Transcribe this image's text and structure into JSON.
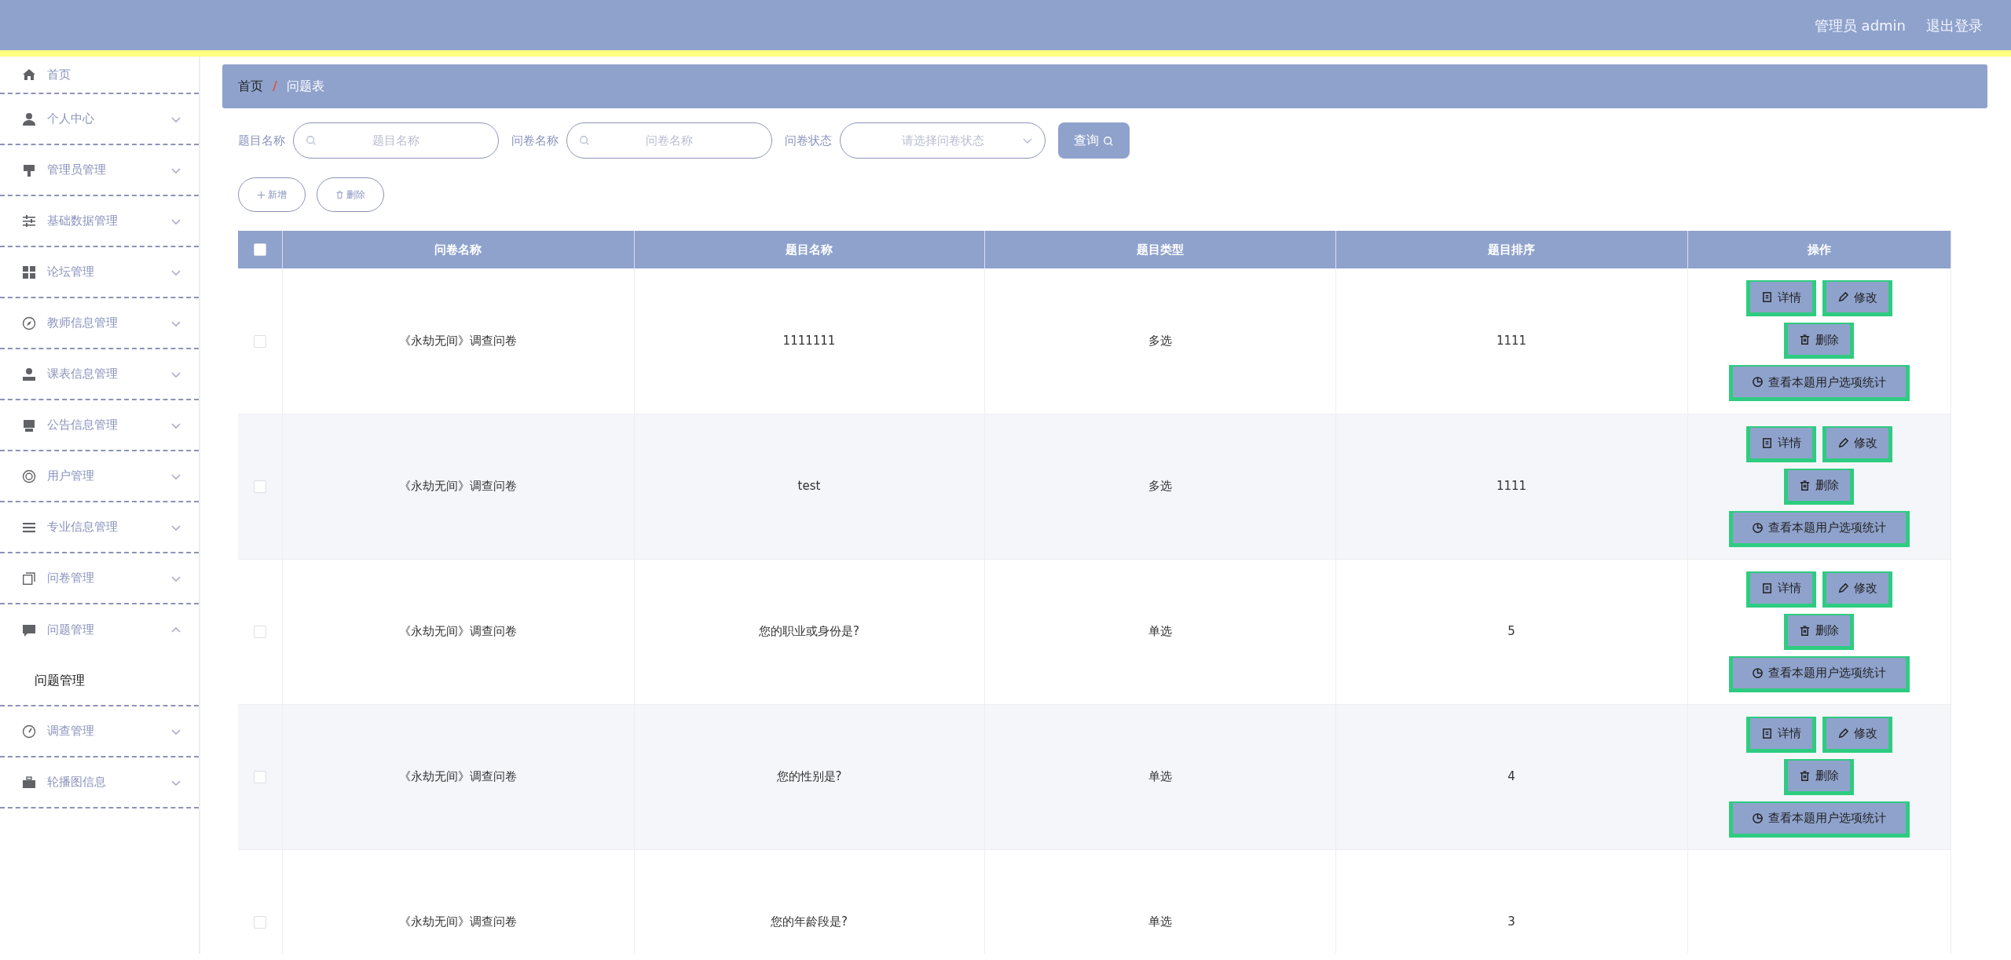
{
  "header": {
    "user": "管理员 admin",
    "logout": "退出登录"
  },
  "sidebar": {
    "items": [
      {
        "kind": "link",
        "label": "首页"
      },
      {
        "kind": "menu",
        "label": "个人中心",
        "expanded": false
      },
      {
        "kind": "menu",
        "label": "管理员管理",
        "expanded": false
      },
      {
        "kind": "menu",
        "label": "基础数据管理",
        "expanded": false
      },
      {
        "kind": "menu",
        "label": "论坛管理",
        "expanded": false
      },
      {
        "kind": "menu",
        "label": "教师信息管理",
        "expanded": false
      },
      {
        "kind": "menu",
        "label": "课表信息管理",
        "expanded": false
      },
      {
        "kind": "menu",
        "label": "公告信息管理",
        "expanded": false
      },
      {
        "kind": "menu",
        "label": "用户管理",
        "expanded": false
      },
      {
        "kind": "menu",
        "label": "专业信息管理",
        "expanded": false
      },
      {
        "kind": "menu",
        "label": "问卷管理",
        "expanded": false
      },
      {
        "kind": "menu",
        "label": "问题管理",
        "expanded": true,
        "children": [
          {
            "label": "问题管理"
          }
        ]
      },
      {
        "kind": "menu",
        "label": "调查管理",
        "expanded": false
      },
      {
        "kind": "menu",
        "label": "轮播图信息",
        "expanded": false
      }
    ]
  },
  "breadcrumb": {
    "items": [
      "首页",
      "问题表"
    ],
    "separator": "/"
  },
  "filters": [
    {
      "kind": "search",
      "label": "题目名称",
      "placeholder": "题目名称"
    },
    {
      "kind": "search",
      "label": "问卷名称",
      "placeholder": "问卷名称"
    },
    {
      "kind": "select",
      "label": "问卷状态",
      "placeholder": "请选择问卷状态"
    }
  ],
  "query_button": "查询",
  "toolbar": [
    {
      "kind": "add",
      "label": "新增"
    },
    {
      "kind": "delete",
      "label": "删除"
    }
  ],
  "table": {
    "header_checked": false,
    "columns": [
      "问卷名称",
      "题目名称",
      "题目类型",
      "题目排序",
      "操作"
    ],
    "rows": [
      {
        "checked": false,
        "cells": [
          "《永劫无间》调查问卷",
          "1111111",
          "多选",
          "1111"
        ],
        "actions": [
          {
            "kind": "detail",
            "label": "详情"
          },
          {
            "kind": "edit",
            "label": "修改"
          },
          {
            "kind": "delete",
            "label": "删除"
          },
          {
            "kind": "stats",
            "label": "查看本题用户选项统计"
          }
        ]
      },
      {
        "checked": false,
        "cells": [
          "《永劫无间》调查问卷",
          "test",
          "多选",
          "1111"
        ],
        "actions": [
          {
            "kind": "detail",
            "label": "详情"
          },
          {
            "kind": "edit",
            "label": "修改"
          },
          {
            "kind": "delete",
            "label": "删除"
          },
          {
            "kind": "stats",
            "label": "查看本题用户选项统计"
          }
        ]
      },
      {
        "checked": false,
        "cells": [
          "《永劫无间》调查问卷",
          "您的职业或身份是?",
          "单选",
          "5"
        ],
        "actions": [
          {
            "kind": "detail",
            "label": "详情"
          },
          {
            "kind": "edit",
            "label": "修改"
          },
          {
            "kind": "delete",
            "label": "删除"
          },
          {
            "kind": "stats",
            "label": "查看本题用户选项统计"
          }
        ]
      },
      {
        "checked": false,
        "cells": [
          "《永劫无间》调查问卷",
          "您的性别是?",
          "单选",
          "4"
        ],
        "actions": [
          {
            "kind": "detail",
            "label": "详情"
          },
          {
            "kind": "edit",
            "label": "修改"
          },
          {
            "kind": "delete",
            "label": "删除"
          },
          {
            "kind": "stats",
            "label": "查看本题用户选项统计"
          }
        ]
      },
      {
        "checked": false,
        "cells": [
          "《永劫无间》调查问卷",
          "您的年龄段是?",
          "单选",
          "3"
        ],
        "actions": []
      }
    ]
  }
}
